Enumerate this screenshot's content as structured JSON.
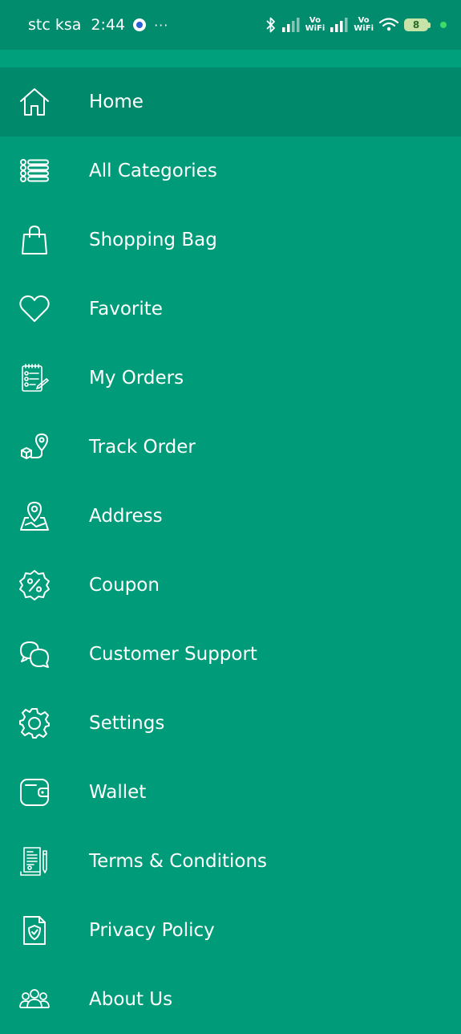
{
  "status_bar": {
    "carrier": "stc ksa",
    "time": "2:44",
    "more": "···",
    "vowifi_1": "Vo\nWiFi",
    "vowifi_2": "Vo\nWiFi",
    "battery_level": "8"
  },
  "menu": {
    "items": [
      {
        "label": "Home",
        "icon": "home-icon",
        "active": true
      },
      {
        "label": "All Categories",
        "icon": "list-icon"
      },
      {
        "label": "Shopping Bag",
        "icon": "shopping-bag-icon"
      },
      {
        "label": "Favorite",
        "icon": "heart-icon"
      },
      {
        "label": "My Orders",
        "icon": "orders-clipboard-icon"
      },
      {
        "label": "Track Order",
        "icon": "track-location-icon"
      },
      {
        "label": "Address",
        "icon": "map-pin-icon"
      },
      {
        "label": "Coupon",
        "icon": "discount-badge-icon"
      },
      {
        "label": "Customer Support",
        "icon": "chat-bubbles-icon"
      },
      {
        "label": "Settings",
        "icon": "gear-icon"
      },
      {
        "label": "Wallet",
        "icon": "wallet-icon"
      },
      {
        "label": "Terms & Conditions",
        "icon": "document-pen-icon"
      },
      {
        "label": "Privacy Policy",
        "icon": "shield-document-icon"
      },
      {
        "label": "About Us",
        "icon": "people-group-icon"
      }
    ]
  },
  "colors": {
    "drawer_bg": "#009c7a",
    "status_bg": "#008c6d",
    "active_bg": "#008a6b",
    "text": "#ffffff"
  }
}
